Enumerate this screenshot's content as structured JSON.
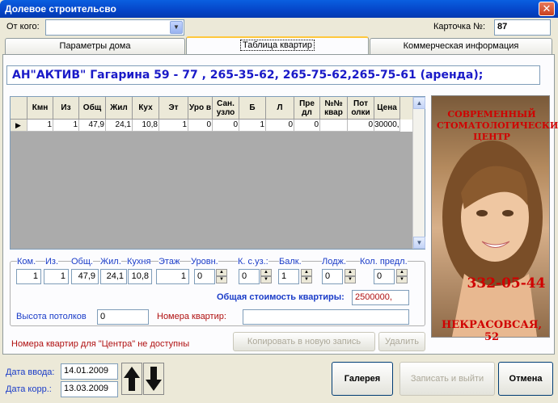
{
  "window": {
    "title": "Долевое строительсво",
    "close": "✕"
  },
  "header": {
    "from_label": "От кого:",
    "from_value": "",
    "card_label": "Карточка №:",
    "card_value": "87"
  },
  "tabs": [
    "Параметры дома",
    "Таблица квартир",
    "Коммерческая информация"
  ],
  "agency_text": "АН\"АКТИВ\" Гагарина 59 - 77 ,  265-35-62, 265-75-62,265-75-61 (аренда);",
  "table": {
    "columns": [
      "Кмн",
      "Из",
      "Общ",
      "Жил",
      "Кух",
      "Эт",
      "Уро в",
      "Сан. узло",
      "Б",
      "Л",
      "Пре дл",
      "№№ квар",
      "Пот олки",
      "Цена"
    ],
    "rows": [
      [
        "1",
        "1",
        "47,9",
        "24,1",
        "10,8",
        "1",
        "0",
        "0",
        "1",
        "0",
        "0",
        "",
        "0",
        "30000,"
      ]
    ]
  },
  "form": {
    "labels": {
      "kom": "Ком.",
      "iz": "Из.",
      "obsh": "Общ.",
      "zhil": "Жил.",
      "kuhnya": "Кухня",
      "etazh": "Этаж",
      "urovn": "Уровн.",
      "ksuz": "К. с.уз.:",
      "balk": "Балк.",
      "lodzh": "Лодж.",
      "koled": "Кол. предл."
    },
    "values": {
      "kom": "1",
      "iz": "1",
      "obsh": "47,9",
      "zhil": "24,1",
      "kuhnya": "10,8",
      "etazh": "1",
      "urovn": "0",
      "ksuz": "0",
      "balk": "1",
      "lodzh": "0",
      "koled": "0"
    },
    "total_cost_label": "Общая стоимость квартиры:",
    "total_cost_value": "2500000,",
    "ceiling_label": "Высота потолков",
    "ceiling_value": "0",
    "numbers_label": "Номера квартир:",
    "numbers_value": "",
    "warning": "Номера квартир для \"Центра\" не доступны",
    "copy_button": "Копировать в новую запись",
    "delete_button": "Удалить"
  },
  "ad": {
    "line1": "СОВРЕМЕННЫЙ СТОМАТОЛОГИЧЕСКИЙ ЦЕНТР",
    "phone": "332-05-44",
    "address": "НЕКРАСОВСАЯ, 52"
  },
  "footer": {
    "date_entry_label": "Дата ввода:",
    "date_entry": "14.01.2009",
    "date_mod_label": "Дата корр.:",
    "date_mod": "13.03.2009",
    "gallery_button": "Галерея",
    "save_exit_button": "Записать и выйти",
    "cancel_button": "Отмена"
  },
  "colors": {
    "titlebar": "#0545C8",
    "accent_blue": "#1A3CC8",
    "warning_red": "#B01010",
    "ad_red": "#D00000"
  }
}
